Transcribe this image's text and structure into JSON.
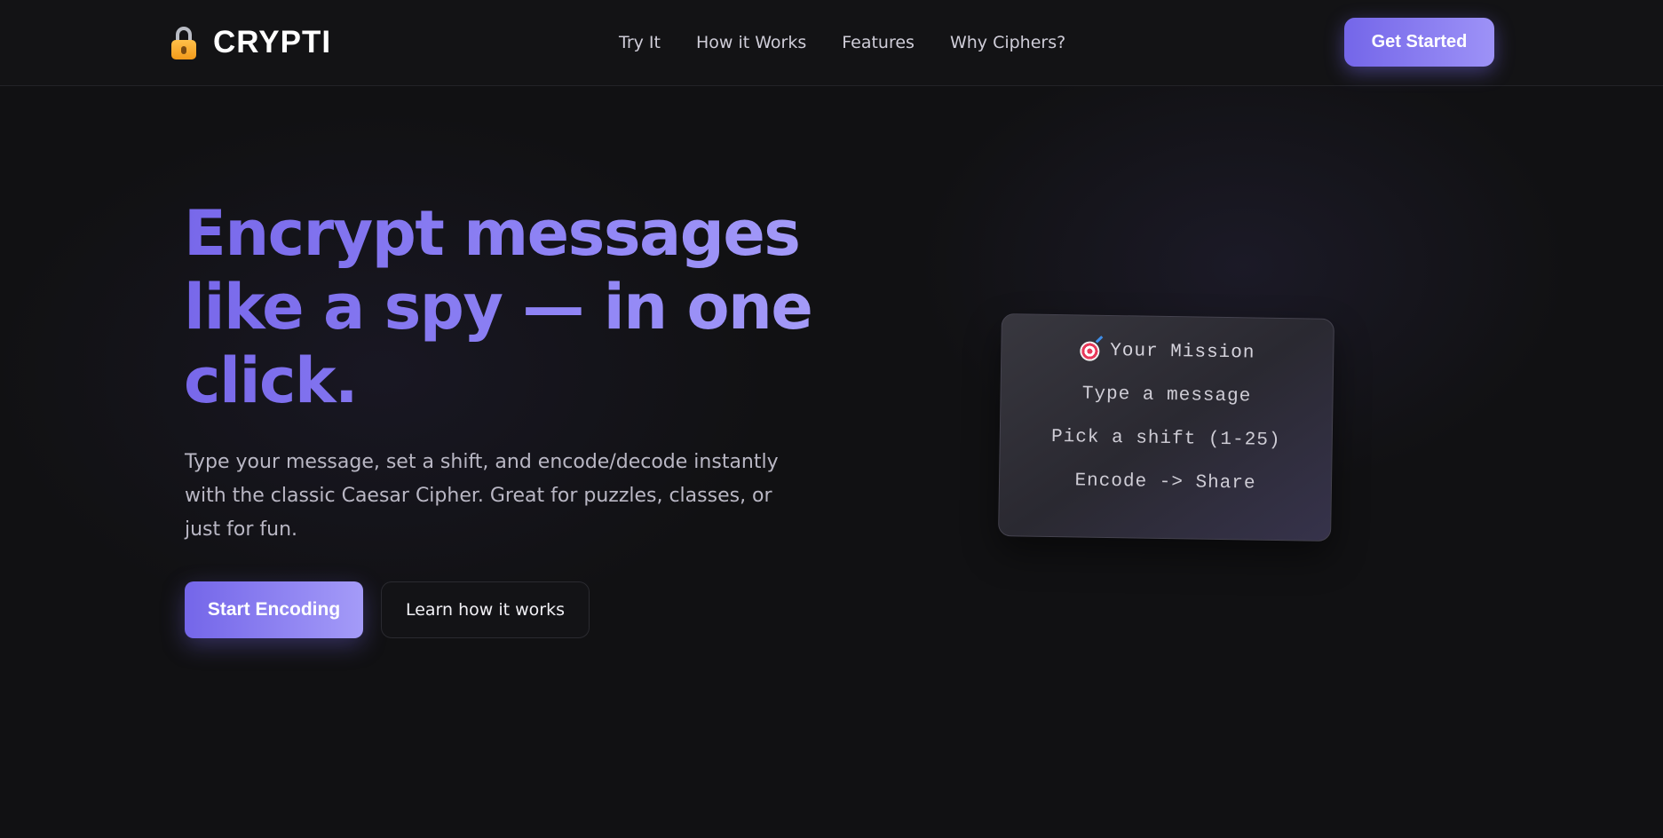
{
  "brand": {
    "name": "CRYPTI",
    "icon": "lock-icon"
  },
  "nav": {
    "items": [
      {
        "label": "Try It"
      },
      {
        "label": "How it Works"
      },
      {
        "label": "Features"
      },
      {
        "label": "Why Ciphers?"
      }
    ],
    "cta_label": "Get Started"
  },
  "hero": {
    "title": "Encrypt messages like a spy — in one click.",
    "subtitle": "Type your message, set a shift, and encode/decode instantly with the classic Caesar Cipher. Great for puzzles, classes, or just for fun.",
    "primary_button": "Start Encoding",
    "secondary_button": "Learn how it works"
  },
  "mission_card": {
    "icon": "target-icon",
    "title": "Your Mission",
    "steps": [
      "Type a message",
      "Pick a shift (1-25)",
      "Encode -> Share"
    ]
  },
  "colors": {
    "accent": "#7466e9",
    "accent_light": "#a49bf8",
    "background": "#111113"
  }
}
